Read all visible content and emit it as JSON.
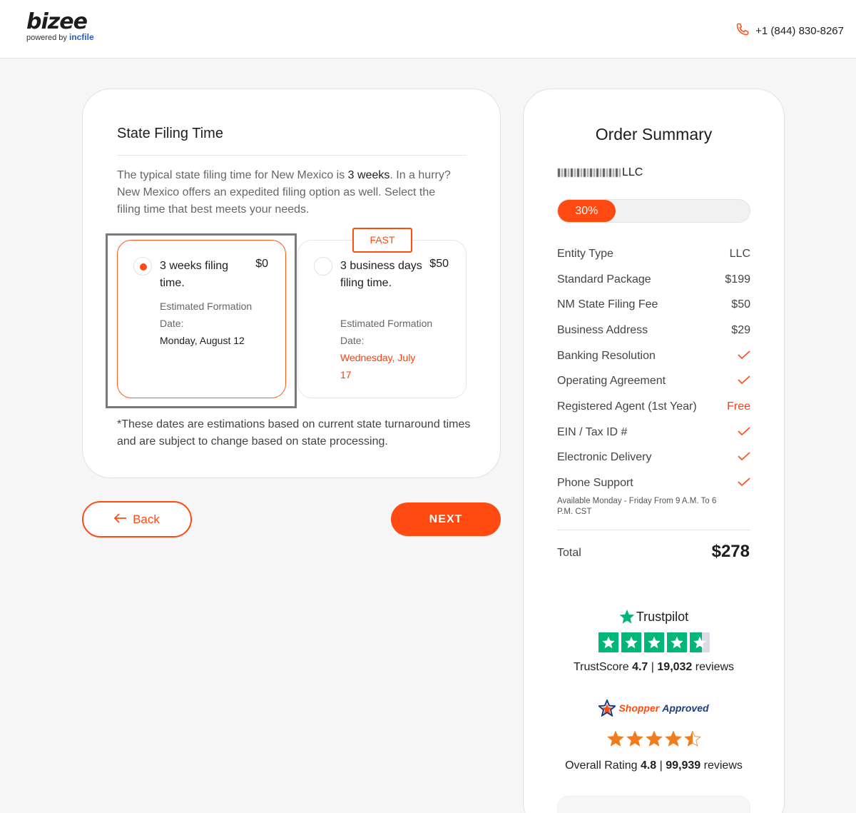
{
  "header": {
    "logo_main": "bizee",
    "logo_sub_prefix": "powered by",
    "logo_sub_brand": "incfile",
    "phone": "+1 (844) 830-8267"
  },
  "filing": {
    "title": "State Filing Time",
    "desc_1": "The typical state filing time for New Mexico is ",
    "desc_bold": "3 weeks",
    "desc_2": ". In a hurry? New Mexico offers an expedited filing option as well. Select the filing time that best meets your needs.",
    "options": [
      {
        "label": "3 weeks filing time.",
        "price": "$0",
        "est_label": "Estimated Formation Date:",
        "date": "Monday, August 12",
        "selected": true
      },
      {
        "label": "3 business days filing time.",
        "price": "$50",
        "est_label": "Estimated Formation Date:",
        "date": "Wednesday, July 17",
        "selected": false,
        "badge": "FAST"
      }
    ],
    "note": "*These dates are estimations based on current state turnaround times and are subject to change based on state processing."
  },
  "nav": {
    "back_label": "Back",
    "next_label": "NEXT"
  },
  "summary": {
    "title": "Order Summary",
    "company_suffix": "LLC",
    "progress_label": "30%",
    "progress_value": 0.3,
    "lines": [
      {
        "label": "Entity Type",
        "value": "LLC",
        "type": "text"
      },
      {
        "label": "Standard Package",
        "value": "$199",
        "type": "text"
      },
      {
        "label": "NM State Filing Fee",
        "value": "$50",
        "type": "text"
      },
      {
        "label": "Business Address",
        "value": "$29",
        "type": "text"
      },
      {
        "label": "Banking Resolution",
        "value": "",
        "type": "check"
      },
      {
        "label": "Operating Agreement",
        "value": "",
        "type": "check"
      },
      {
        "label": "Registered Agent (1st Year)",
        "value": "Free",
        "type": "free"
      },
      {
        "label": "EIN / Tax ID #",
        "value": "",
        "type": "check"
      },
      {
        "label": "Electronic Delivery",
        "value": "",
        "type": "check"
      },
      {
        "label": "Phone Support",
        "value": "",
        "type": "check"
      }
    ],
    "phone_note": "Available Monday - Friday From 9 A.M. To 6 P.M. CST",
    "total_label": "Total",
    "total_value": "$278"
  },
  "trustpilot": {
    "brand": "Trustpilot",
    "score_label": "TrustScore",
    "score": "4.7",
    "separator": "|",
    "reviews": "19,032",
    "reviews_label": "reviews",
    "rating_stars": 4.5
  },
  "shopper_approved": {
    "brand_1": "Shopper",
    "brand_2": "Approved",
    "rating_label": "Overall Rating",
    "score": "4.8",
    "separator": "|",
    "reviews": "99,939",
    "reviews_label": "reviews",
    "rating_stars": 4.5
  },
  "colors": {
    "accent": "#ff4a12",
    "trustpilot_green": "#00b67a",
    "star_orange": "#f07c1c"
  }
}
